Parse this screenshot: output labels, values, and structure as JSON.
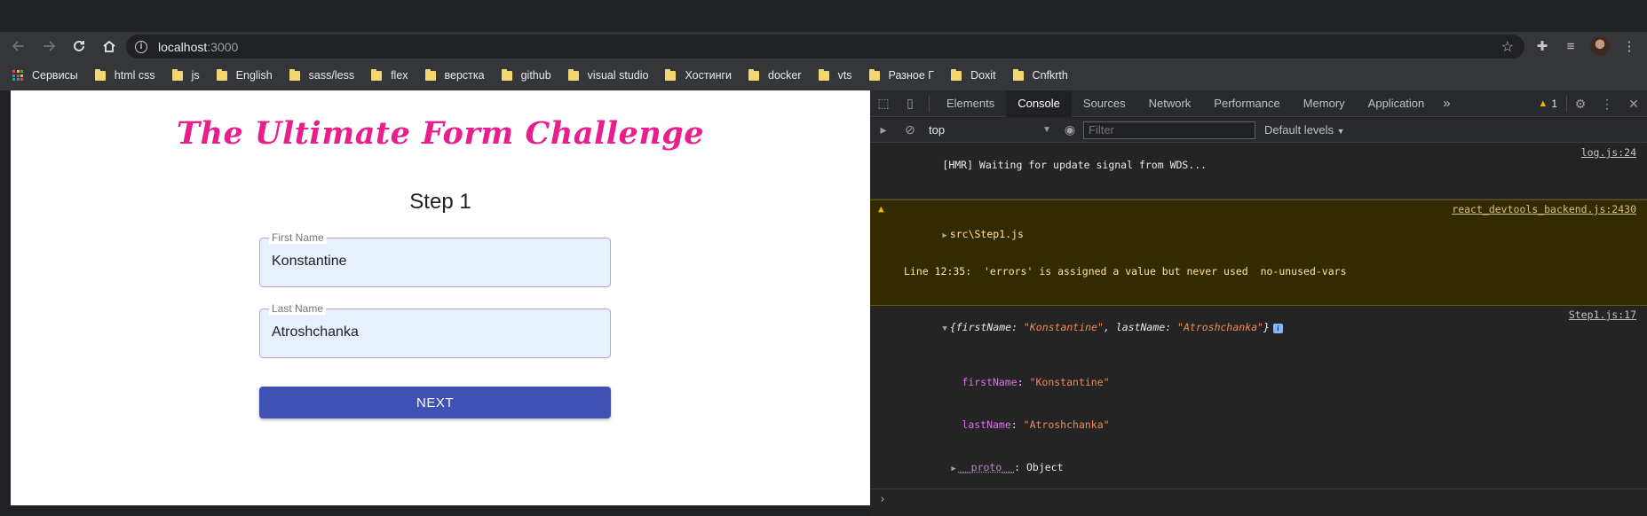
{
  "browser": {
    "url_host": "localhost",
    "url_port": ":3000",
    "bookmarks": [
      {
        "label": "Сервисы",
        "icon": "apps-grid-icon"
      },
      {
        "label": "html css",
        "icon": "folder-icon"
      },
      {
        "label": "js",
        "icon": "folder-icon"
      },
      {
        "label": "English",
        "icon": "folder-icon"
      },
      {
        "label": "sass/less",
        "icon": "folder-icon"
      },
      {
        "label": "flex",
        "icon": "folder-icon"
      },
      {
        "label": "верстка",
        "icon": "folder-icon"
      },
      {
        "label": "github",
        "icon": "folder-icon"
      },
      {
        "label": "visual studio",
        "icon": "folder-icon"
      },
      {
        "label": "Хостинги",
        "icon": "folder-icon"
      },
      {
        "label": "docker",
        "icon": "folder-icon"
      },
      {
        "label": "vts",
        "icon": "folder-icon"
      },
      {
        "label": "Разное Г",
        "icon": "folder-icon"
      },
      {
        "label": "Doxit",
        "icon": "folder-icon"
      },
      {
        "label": "Cnfkrth",
        "icon": "folder-icon"
      }
    ]
  },
  "app": {
    "title": "The Ultimate Form Challenge",
    "step": "Step 1",
    "first_name_label": "First Name",
    "first_name_value": "Konstantine",
    "last_name_label": "Last Name",
    "last_name_value": "Atroshchanka",
    "next_label": "NEXT",
    "title_color": "#e91e8c",
    "button_color": "#3f51b5"
  },
  "devtools": {
    "tabs": [
      "Elements",
      "Console",
      "Sources",
      "Network",
      "Performance",
      "Memory",
      "Application"
    ],
    "active_tab": "Console",
    "warning_count": "1",
    "context": "top",
    "filter_placeholder": "Filter",
    "levels": "Default levels",
    "console": {
      "hmr_text": "[HMR] Waiting for update signal from WDS...",
      "hmr_src": "log.js:24",
      "warn_file": "src\\Step1.js",
      "warn_detail": "Line 12:35:  'errors' is assigned a value but never used  no-unused-vars",
      "warn_src": "react_devtools_backend.js:2430",
      "obj_open": "{",
      "obj_k1": "firstName",
      "obj_v1": "\"Konstantine\"",
      "obj_comma": ", ",
      "obj_k2": "lastName",
      "obj_v2": "\"Atroshchanka\"",
      "obj_close": "}",
      "obj_src": "Step1.js:17",
      "prop1_key": "firstName",
      "prop1_val": "\"Konstantine\"",
      "prop2_key": "lastName",
      "prop2_val": "\"Atroshchanka\"",
      "proto_key": "__proto__",
      "proto_val": "Object",
      "colon": ": "
    }
  }
}
